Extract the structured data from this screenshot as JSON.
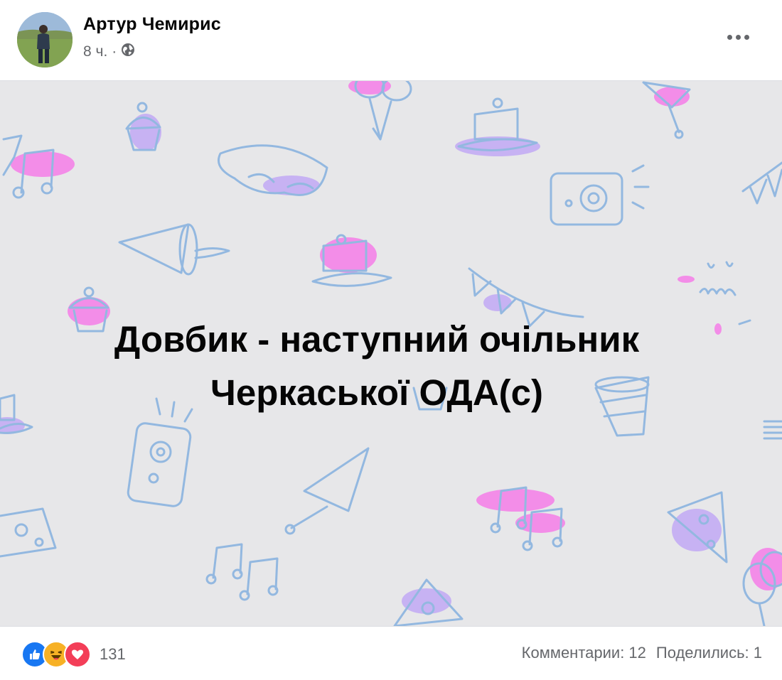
{
  "post": {
    "author": "Артур Чемирис",
    "time": "8 ч.",
    "separator": "·",
    "privacy_icon": "globe-icon",
    "more_icon": "more-horizontal-icon",
    "image": {
      "background": "#e7e7e9",
      "headline_line1": "Довбик - наступний очільник",
      "headline_line2": "Черкаської ОДА(с)"
    },
    "reactions": {
      "icons": [
        "like-icon",
        "haha-icon",
        "love-icon"
      ],
      "count": "131"
    },
    "comments_text": "Комментарии: 12",
    "shares_text": "Поделились: 1"
  },
  "colors": {
    "like": "#1877f2",
    "haha": "#f7b125",
    "love": "#f33e58",
    "pattern_line": "#93b8e0",
    "pattern_pink": "#f38de8",
    "pattern_purple": "#c7b2f3"
  }
}
